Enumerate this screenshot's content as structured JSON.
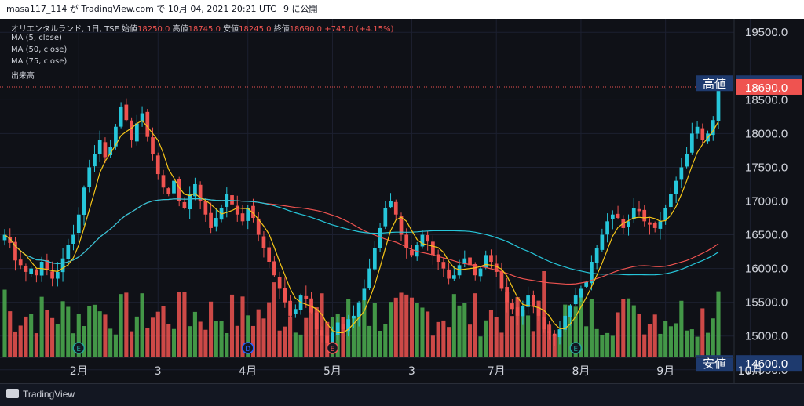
{
  "header": {
    "text": "masa117_114 が TradingView.com で 10月 04, 2021 20:21 UTC+9 に公開"
  },
  "legend": {
    "symbol": "オリエンタルランド, 1日, TSE",
    "open_label": "始値",
    "open": "18250.0",
    "high_label": "高値",
    "high": "18745.0",
    "low_label": "安値",
    "low": "18245.0",
    "close_label": "終値",
    "close": "18690.0",
    "change": "+745.0 (+4.15%)",
    "ma5": "MA (5, close)",
    "ma50": "MA (50, close)",
    "ma75": "MA (75, close)",
    "volume": "出来高"
  },
  "footer": {
    "brand": "TradingView"
  },
  "colors": {
    "up": "#4caf50",
    "down": "#ef5350",
    "ma5": "#f5c518",
    "ma50": "#ef5350",
    "ma75": "#26c6da",
    "axis_label_bg": "#1e3a6e",
    "last_price_bg": "#ef5350"
  },
  "chart_data": {
    "type": "candlestick",
    "title": "オリエンタルランド, 1日, TSE",
    "ylim": [
      14300,
      19700
    ],
    "y_ticks": [
      "19500.0",
      "18500.0",
      "18000.0",
      "17500.0",
      "17000.0",
      "16500.0",
      "16000.0",
      "15500.0",
      "15000.0",
      "14500.0"
    ],
    "x_ticks": [
      {
        "label": "2月",
        "i": 14
      },
      {
        "label": "3",
        "i": 29
      },
      {
        "label": "4月",
        "i": 46
      },
      {
        "label": "5月",
        "i": 62
      },
      {
        "label": "3",
        "i": 77
      },
      {
        "label": "7月",
        "i": 93
      },
      {
        "label": "8月",
        "i": 109
      },
      {
        "label": "9月",
        "i": 125
      },
      {
        "label": "10月",
        "i": 141
      }
    ],
    "markers": [
      {
        "label": "E",
        "i": 14,
        "color": "#26a69a"
      },
      {
        "label": "D",
        "i": 46,
        "color": "#2962ff"
      },
      {
        "label": "E",
        "i": 62,
        "color": "#ef5350"
      },
      {
        "label": "E",
        "i": 108,
        "color": "#26a69a"
      }
    ],
    "price_labels": [
      {
        "label": "高値",
        "value": "18745.0",
        "price": 18745,
        "bg": "#1e3a6e"
      },
      {
        "label": "",
        "value": "18690.0",
        "price": 18690,
        "bg": "#ef5350"
      },
      {
        "label": "安値",
        "value": "14600.0",
        "price": 14600,
        "bg": "#1e3a6e"
      }
    ],
    "last_close": 18690,
    "series": [
      {
        "name": "MA (5, close)",
        "color": "#f5c518"
      },
      {
        "name": "MA (50, close)",
        "color": "#ef5350"
      },
      {
        "name": "MA (75, close)",
        "color": "#26c6da"
      },
      {
        "name": "出来高"
      }
    ],
    "closes": [
      16500,
      16380,
      16120,
      16050,
      15950,
      16000,
      15900,
      16100,
      15980,
      15850,
      15950,
      16150,
      16350,
      16500,
      16800,
      17200,
      17500,
      17700,
      17900,
      17650,
      17800,
      18100,
      18400,
      18200,
      17900,
      18150,
      18300,
      17950,
      17700,
      17400,
      17200,
      17100,
      17300,
      17000,
      16900,
      17100,
      17250,
      17000,
      16800,
      16600,
      16750,
      16900,
      17100,
      16950,
      16800,
      16700,
      16900,
      16750,
      16500,
      16300,
      16100,
      15900,
      15700,
      15500,
      15300,
      15400,
      15600,
      15550,
      15350,
      15100,
      15000,
      14900,
      15050,
      15200,
      15100,
      15250,
      15300,
      15500,
      15700,
      16000,
      16300,
      16600,
      16900,
      17000,
      16800,
      16500,
      16300,
      16200,
      16350,
      16500,
      16400,
      16200,
      16100,
      16000,
      15850,
      15900,
      16050,
      16150,
      16050,
      15900,
      16000,
      16200,
      16100,
      15950,
      15700,
      15500,
      15400,
      15300,
      15450,
      15600,
      15450,
      15300,
      15100,
      15050,
      15000,
      15100,
      15300,
      15450,
      15600,
      15700,
      15800,
      16100,
      16300,
      16500,
      16700,
      16800,
      16750,
      16600,
      16700,
      16900,
      16850,
      16700,
      16650,
      16600,
      16700,
      16900,
      17100,
      17300,
      17500,
      17700,
      18000,
      18100,
      17900,
      18000,
      18200,
      18690
    ]
  }
}
